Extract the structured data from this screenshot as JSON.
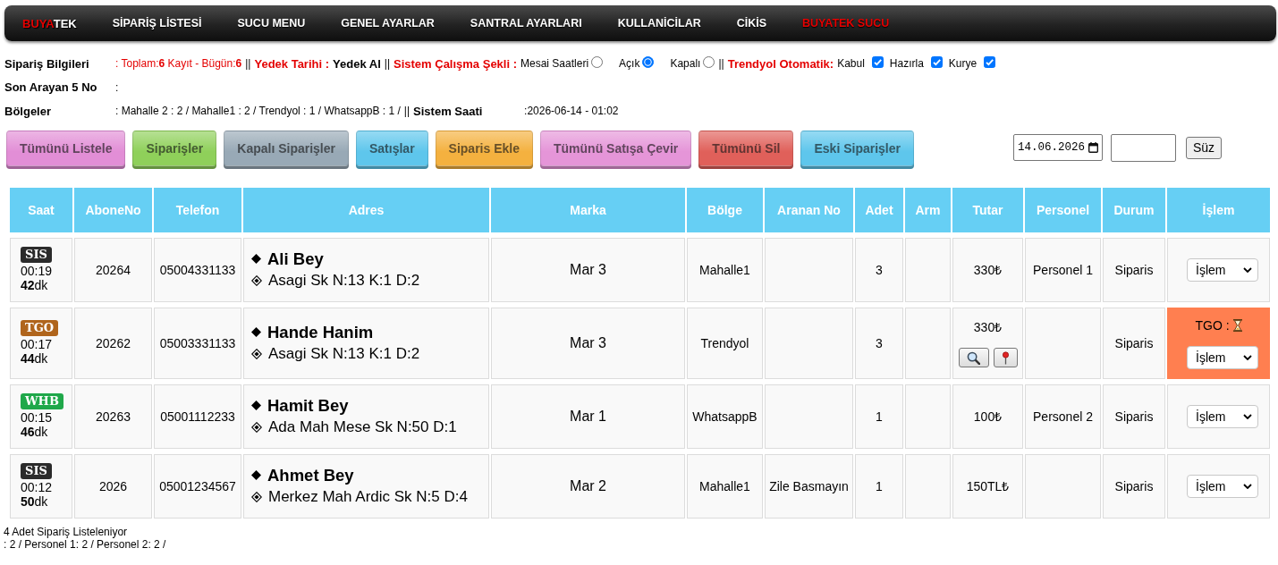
{
  "nav": {
    "logo": {
      "accent": "BUYA",
      "rest": "TEK"
    },
    "items": [
      {
        "label": "SİPARİŞ LİSTESİ",
        "highlighted": false
      },
      {
        "label": "SUCU MENU",
        "highlighted": false
      },
      {
        "label": "GENEL AYARLAR",
        "highlighted": false
      },
      {
        "label": "SANTRAL AYARLARI",
        "highlighted": false
      },
      {
        "label": "KULLANİCİLAR",
        "highlighted": false
      },
      {
        "label": "CİKİS",
        "highlighted": false
      },
      {
        "label": "BUYATEK SUCU",
        "highlighted": true
      }
    ]
  },
  "info": [
    {
      "label": "Sipariş Bilgileri",
      "segments": [
        {
          "kind": "note",
          "text": ": Toplam:**6** Kayıt - Bügün:**6**"
        },
        {
          "kind": "sep",
          "text": "||"
        },
        {
          "kind": "key",
          "text": "Yedek Tarihi :"
        },
        {
          "kind": "link",
          "text": "Yedek Al"
        },
        {
          "kind": "sep",
          "text": "||"
        },
        {
          "kind": "key",
          "text": "Sistem Çalışma Şekli :"
        },
        {
          "kind": "radios",
          "options": [
            {
              "label": "Mesai Saatleri",
              "selected": false
            },
            {
              "label": "Açık",
              "selected": true
            },
            {
              "label": "Kapalı",
              "selected": false
            }
          ]
        },
        {
          "kind": "sep",
          "text": "||"
        },
        {
          "kind": "key",
          "text": "Trendyol Otomatik:"
        },
        {
          "kind": "checkboxes",
          "options": [
            {
              "label": "Kabul",
              "checked": true
            },
            {
              "label": "Hazırla",
              "checked": true
            },
            {
              "label": "Kurye",
              "checked": true
            }
          ]
        }
      ]
    },
    {
      "label": "Son Arayan 5 No",
      "segments": [
        {
          "kind": "plain",
          "text": ":"
        }
      ]
    },
    {
      "label": "Bölgeler",
      "segments": [
        {
          "kind": "plain",
          "text": ": Mahalle 2 : 2 / Mahalle1 : 2 / Trendyol : 1 / WhatsappB : 1 /"
        },
        {
          "kind": "sep",
          "text": "||"
        },
        {
          "kind": "strong",
          "text": "Sistem Saati"
        },
        {
          "kind": "plain",
          "text": ":2026-06-14 - 01:02"
        }
      ]
    }
  ],
  "actions": [
    {
      "label": "Tümünü Listele",
      "color": "#e28ed6"
    },
    {
      "label": "Siparişler",
      "color": "#8fd05a"
    },
    {
      "label": "Kapalı Siparişler",
      "color": "#98a9b6"
    },
    {
      "label": "Satışlar",
      "color": "#5ec6ec"
    },
    {
      "label": "Siparis Ekle",
      "color": "#f4b13f"
    },
    {
      "label": "Tümünü Satışa Çevir",
      "color": "#e595d8"
    },
    {
      "label": "Tümünü Sil",
      "color": "#e0605a"
    },
    {
      "label": "Eski Siparişler",
      "color": "#5ec6ec"
    }
  ],
  "filter": {
    "date": "14.06.2026",
    "button": "Süz"
  },
  "table": {
    "columns": [
      "Saat",
      "AboneNo",
      "Telefon",
      "Adres",
      "Marka",
      "Bölge",
      "Aranan No",
      "Adet",
      "Arm",
      "Tutar",
      "Personel",
      "Durum",
      "İşlem"
    ],
    "rows": [
      {
        "badge": {
          "label": "SIS",
          "color": "#2b2b2b"
        },
        "time": "00:19",
        "elapsed": "**42**dk",
        "subscriber_no": "20264",
        "phone": "05004331133",
        "customer": "Ali Bey",
        "address": "Asagi Sk N:13 K:1 D:2",
        "brand": "Mar 3",
        "region": "Mahalle1",
        "quantity": "3",
        "total": "330₺",
        "tools": false,
        "staff": "Personel 1",
        "status": "Siparis",
        "highlighted": false,
        "action": "İşlem"
      },
      {
        "badge": {
          "label": "TGO",
          "color": "#b0651c"
        },
        "time": "00:17",
        "elapsed": "**44**dk",
        "subscriber_no": "20262",
        "phone": "05003331133",
        "customer": "Hande Hanim",
        "address": "Asagi Sk N:13 K:1 D:2",
        "brand": "Mar 3",
        "region": "Trendyol",
        "quantity": "3",
        "total": "330₺",
        "tools": true,
        "status": "Siparis",
        "highlighted": true,
        "note": "TGO :",
        "action": "İşlem"
      },
      {
        "badge": {
          "label": "WHB",
          "color": "#1fa84a"
        },
        "time": "00:15",
        "elapsed": "**46**dk",
        "subscriber_no": "20263",
        "phone": "05001112233",
        "customer": "Hamit Bey",
        "address": "Ada Mah Mese Sk N:50 D:1",
        "brand": "Mar 1",
        "region": "WhatsappB",
        "quantity": "1",
        "total": "100₺",
        "tools": false,
        "staff": "Personel 2",
        "status": "Siparis",
        "highlighted": false,
        "action": "İşlem"
      },
      {
        "badge": {
          "label": "SIS",
          "color": "#2b2b2b"
        },
        "time": "00:12",
        "elapsed": "**50**dk",
        "subscriber_no": "2026",
        "phone": "05001234567",
        "customer": "Ahmet Bey",
        "address": "Merkez Mah Ardic Sk N:5 D:4",
        "brand": "Mar 2",
        "region": "Mahalle1",
        "called_no": "Zile Basmayın",
        "quantity": "1",
        "total": "150TL₺",
        "tools": false,
        "status": "Siparis",
        "highlighted": false,
        "action": "İşlem"
      }
    ]
  },
  "footer": {
    "count": "4 Adet Sipariş Listeleniyor",
    "staff": ": 2 / Personel 1: 2 / Personel 2: 2 /"
  }
}
